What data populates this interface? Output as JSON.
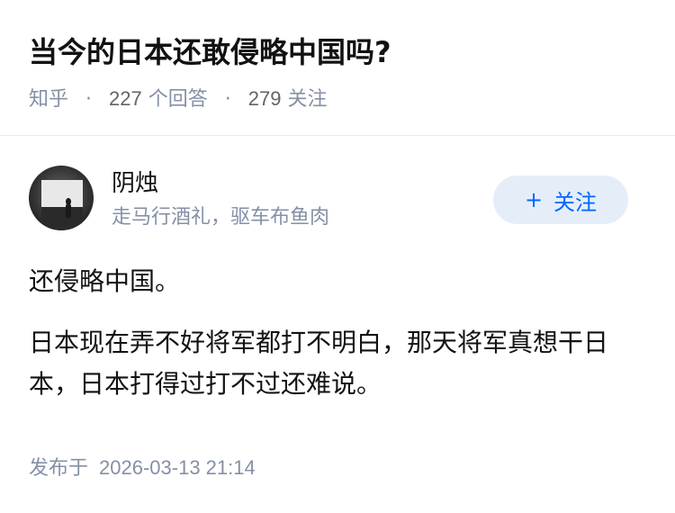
{
  "question": {
    "title": "当今的日本还敢侵略中国吗?",
    "source": "知乎",
    "answer_count": "227",
    "answer_label": "个回答",
    "follower_count": "279",
    "follower_label": "关注",
    "separator": "·"
  },
  "author": {
    "name": "阴烛",
    "bio": "走马行酒礼，驱车布鱼肉",
    "follow_symbol": "+",
    "follow_label": "关注"
  },
  "answer": {
    "paragraphs": [
      "还侵略中国。",
      "日本现在弄不好将军都打不明白，那天将军真想干日本，日本打得过打不过还难说。"
    ]
  },
  "footer": {
    "published_label": "发布于",
    "timestamp": "2026-03-13 21:14"
  },
  "colors": {
    "accent": "#0066ff",
    "follow_bg": "#e5eef8",
    "meta_text": "#8590a6"
  }
}
